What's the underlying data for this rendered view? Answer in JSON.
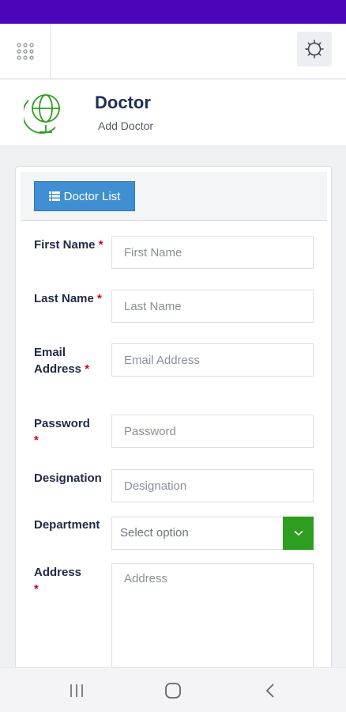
{
  "header": {
    "title": "Doctor",
    "subtitle": "Add Doctor"
  },
  "panel": {
    "list_button_label": "Doctor List"
  },
  "form": {
    "first_name": {
      "label": "First Name",
      "placeholder": "First Name",
      "value": ""
    },
    "last_name": {
      "label": "Last Name",
      "placeholder": "Last Name",
      "value": ""
    },
    "email": {
      "label": "Email Address",
      "placeholder": "Email Address",
      "value": ""
    },
    "password": {
      "label": "Password",
      "placeholder": "Password",
      "value": ""
    },
    "designation": {
      "label": "Designation",
      "placeholder": "Designation",
      "value": ""
    },
    "department": {
      "label": "Department",
      "selected": "Select option"
    },
    "address": {
      "label": "Address",
      "placeholder": "Address",
      "value": ""
    },
    "required_mark": "*"
  },
  "icons": {
    "menu": "grid-icon",
    "settings": "gear-icon",
    "logo": "globe-icon",
    "list": "list-icon",
    "dropdown": "chevron-down-icon",
    "nav_recent": "recent-apps-icon",
    "nav_home": "home-icon",
    "nav_back": "back-icon"
  },
  "colors": {
    "status_bar": "#4a06b8",
    "primary_button": "#3f8fd2",
    "select_button": "#2e9e20",
    "required": "#d0021b",
    "logo": "#2e9e20"
  }
}
